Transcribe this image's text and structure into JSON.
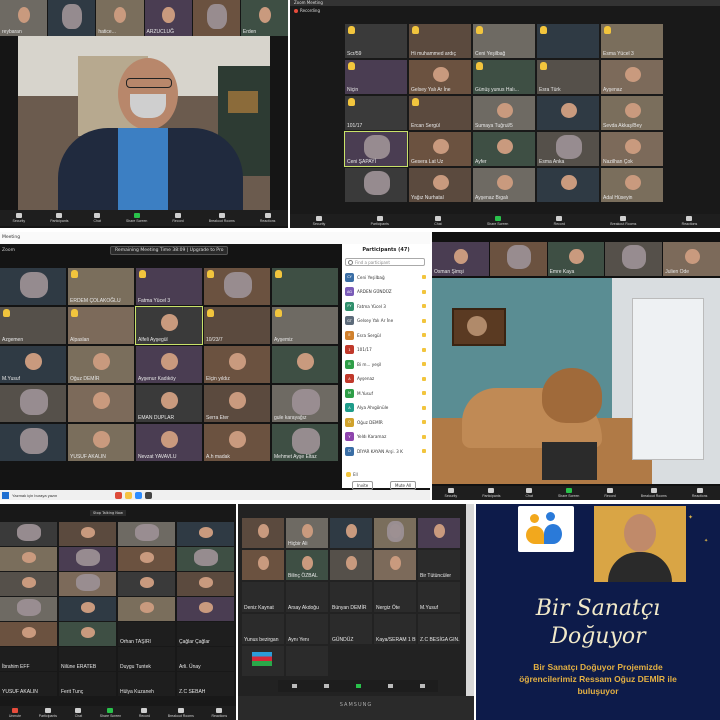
{
  "colors": {
    "zoom_bg": "#1a1a1a",
    "tile_bg": "#262626",
    "hand": "#f2c53d",
    "active_border": "#c9e26a",
    "poster_bg": "#0d1b4a",
    "poster_text": "#f1e9c9",
    "poster_sub": "#e3b043",
    "unmute_red": "#e74c3c",
    "share_green": "#29c24b"
  },
  "p1": {
    "strip": [
      "reybaran",
      "",
      "hatice...",
      "ARZUCLUĞ",
      "",
      "Erden"
    ],
    "toolbar": [
      "Security",
      "Participants",
      "Chat",
      "Share Screen",
      "Record",
      "Breakout Rooms",
      "Reactions"
    ]
  },
  "p2": {
    "title": "Zoom Meeting",
    "recording": "Recording",
    "tiles": [
      "Scr/59",
      "Hi muhammed ardıç",
      "Ceni Yeşilbağ",
      "",
      "Esma Yücel 3",
      "Niçin",
      "Gelsey Yalı Ar İne",
      "Günüş yunus Halı...",
      "Esra Türk",
      "Ayşenaz",
      "101/17",
      "Ercan Sergül",
      "Sumaya Tuğrul/5",
      "",
      "Sevda Akkaş/Bey",
      "Ceni ŞAPAYİ",
      "Gesera Lat Uz",
      "Ayfer",
      "Esma Anka",
      "Nazilhan Çok",
      "",
      "Yağız Nurhatal",
      "Ayşenaz Bıgalı",
      "",
      "Adal Hüseyin"
    ],
    "toolbar": [
      "Security",
      "Participants",
      "Chat",
      "Share Screen",
      "Record",
      "Breakout Rooms",
      "Reactions"
    ]
  },
  "p3": {
    "banner": "Remaining Meeting Time 38:09 | Upgrade to Pro",
    "title": "Meeting",
    "left_label": "Zoom",
    "tiles": [
      "",
      "ERDEM ÇOLAKOĞLU",
      "Fatma Yücel 3",
      "",
      "",
      "Azgemen",
      "Alpaslan",
      "Alfeli Ayşegül",
      "10/23/7",
      "Ayşemiz",
      "M.Yusuf",
      "Oğuz DEMİR",
      "Ayşenur Kadıköy",
      "Elçin yıldız",
      "",
      "",
      "",
      "EMAN DUPLAR",
      "Serra Eter",
      "gule karayağız",
      "",
      "YUSUF AKALIN",
      "Nevzat YAVAVLU",
      "A.h madak",
      "Mehmet Ayşe Eltaz"
    ],
    "participants_title": "Participants (47)",
    "find": "Find a participant",
    "participants": [
      {
        "av": "CY",
        "name": "Ceni Yeşilbağ",
        "c": "#3a6ea5"
      },
      {
        "av": "AG",
        "name": "ARDEN GÜNDÜZ",
        "c": "#7a5cb8"
      },
      {
        "av": "FY",
        "name": "Fatma Yücel 3",
        "c": "#2f8f6b"
      },
      {
        "av": "GT",
        "name": "Gelsey Yalı Ar İne",
        "c": "#5d6b7a"
      },
      {
        "av": "E",
        "name": "Esra Sergül",
        "c": "#d0802c"
      },
      {
        "av": "1",
        "name": "101/17",
        "c": "#c0392b"
      },
      {
        "av": "B",
        "name": "Bi m... yeşil",
        "c": "#2e9e47"
      },
      {
        "av": "A",
        "name": "Ayşenaz",
        "c": "#c0392b"
      },
      {
        "av": "M",
        "name": "M.Yusuf",
        "c": "#2e9e47"
      },
      {
        "av": "A",
        "name": "Alya Ahıgönüle",
        "c": "#1f9c8a"
      },
      {
        "av": "O",
        "name": "Oğuz DEMİR",
        "c": "#d0a22c"
      },
      {
        "av": "Y",
        "name": "Yeldı Karamaz",
        "c": "#8e44ad"
      },
      {
        "av": "D",
        "name": "DİYAR KAYAN Arşi. 3 K",
        "c": "#3a6ea5"
      }
    ],
    "invite": "Invite",
    "mute_all": "Mute All",
    "reactions_label": "Ell",
    "taskbar_search": "Yazmak için buraya yazın"
  },
  "p4": {
    "strip": [
      "Osman Şimşi",
      "",
      "Emre Kaya",
      "",
      "Julien Ode"
    ],
    "toolbar": [
      "Security",
      "Participants",
      "Chat",
      "Share Screen",
      "Record",
      "Breakout Rooms",
      "Reactions"
    ]
  },
  "p5": {
    "banner": "Stop Talking Now",
    "tiles": [
      "",
      "",
      "",
      "",
      "",
      "",
      "",
      "",
      "",
      "",
      "",
      "",
      "",
      "",
      "",
      "",
      "",
      "",
      "Orhan TAŞIRI",
      "Çağlar Çağlar",
      "İbrahim EFF",
      "Nilüne ERATEB",
      "Duygu Tuntek",
      "Arli. Ünay",
      "YUSUF AKALIN",
      "Ferit Tunç",
      "Hülya Kuzaneh",
      "Z.C SEBAH"
    ],
    "toolbar": [
      "Unmute",
      "Participants",
      "Chat",
      "Share Screen",
      "Record",
      "Breakout Rooms",
      "Reactions"
    ]
  },
  "p6": {
    "tiles": [
      "",
      "Hiçbir Ali",
      "",
      "",
      "",
      "",
      "Bilinç ÖZBAL",
      "",
      "",
      "Bir Tütüncüler",
      "Deniz Kaynat",
      "Arsay Akdoğu",
      "Bünyan DEMİR",
      "Nergiz Öte",
      "M.Yusuf",
      "Yunus bezirgan",
      "Aynı Yenı",
      "GÜNDÜZ",
      "Kaya/SERAM 1 BE",
      "Z.C BESİGA GIN...",
      "",
      ""
    ],
    "laptop_brand": "SAMSUNG"
  },
  "p7": {
    "title_line1": "Bir Sanatçı",
    "title_line2": "Doğuyor",
    "subtitle_line1": "Bir Sanatçı Doğuyor Projemizde",
    "subtitle_line2": "öğrencilerimiz Ressam Oğuz DEMİR ile",
    "subtitle_line3": "buluşuyor"
  }
}
